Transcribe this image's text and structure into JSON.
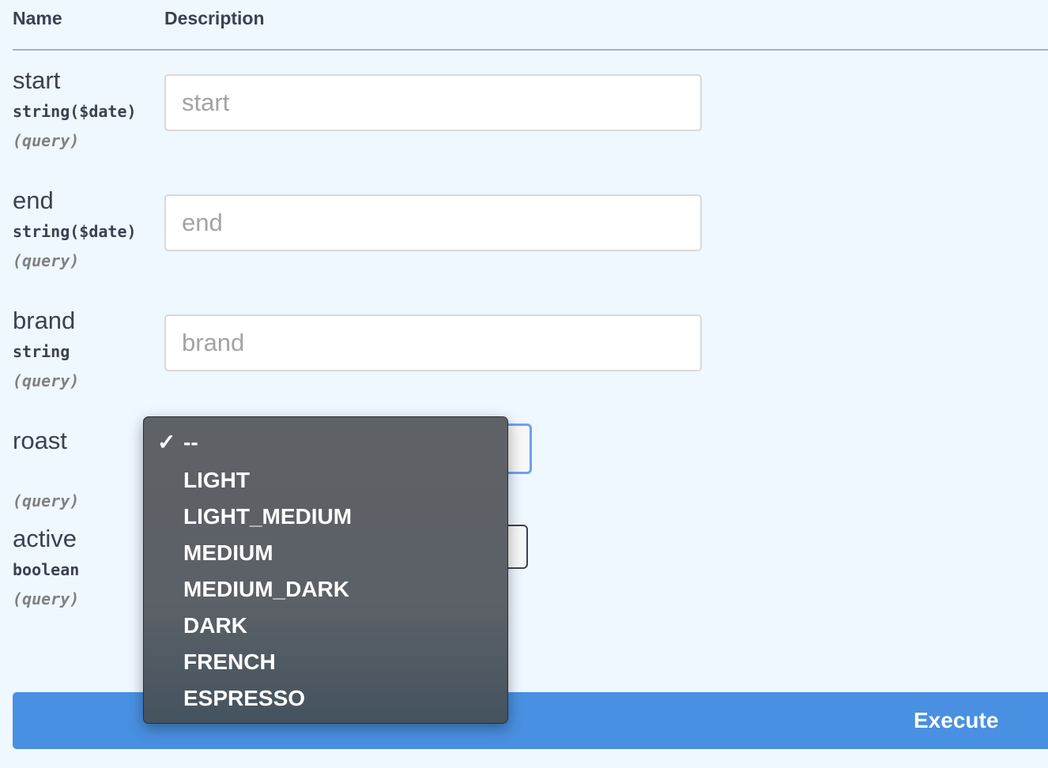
{
  "table": {
    "col_name": "Name",
    "col_description": "Description"
  },
  "params": [
    {
      "name": "start",
      "type": "string($date)",
      "in": "(query)",
      "placeholder": "start"
    },
    {
      "name": "end",
      "type": "string($date)",
      "in": "(query)",
      "placeholder": "end"
    },
    {
      "name": "brand",
      "type": "string",
      "in": "(query)",
      "placeholder": "brand"
    },
    {
      "name": "roast",
      "type": "",
      "in": "(query)"
    },
    {
      "name": "active",
      "type": "boolean",
      "in": "(query)"
    }
  ],
  "dropdown": {
    "check_glyph": "✓",
    "options": [
      "--",
      "LIGHT",
      "LIGHT_MEDIUM",
      "MEDIUM",
      "MEDIUM_DARK",
      "DARK",
      "FRENCH",
      "ESPRESSO"
    ],
    "selected_index": 0
  },
  "execute": {
    "label": "Execute"
  },
  "colors": {
    "background": "#eff7ff",
    "execute_button": "#4990e2",
    "focus_ring": "#6ea1f0",
    "dropdown_bg": "#5e6166"
  }
}
